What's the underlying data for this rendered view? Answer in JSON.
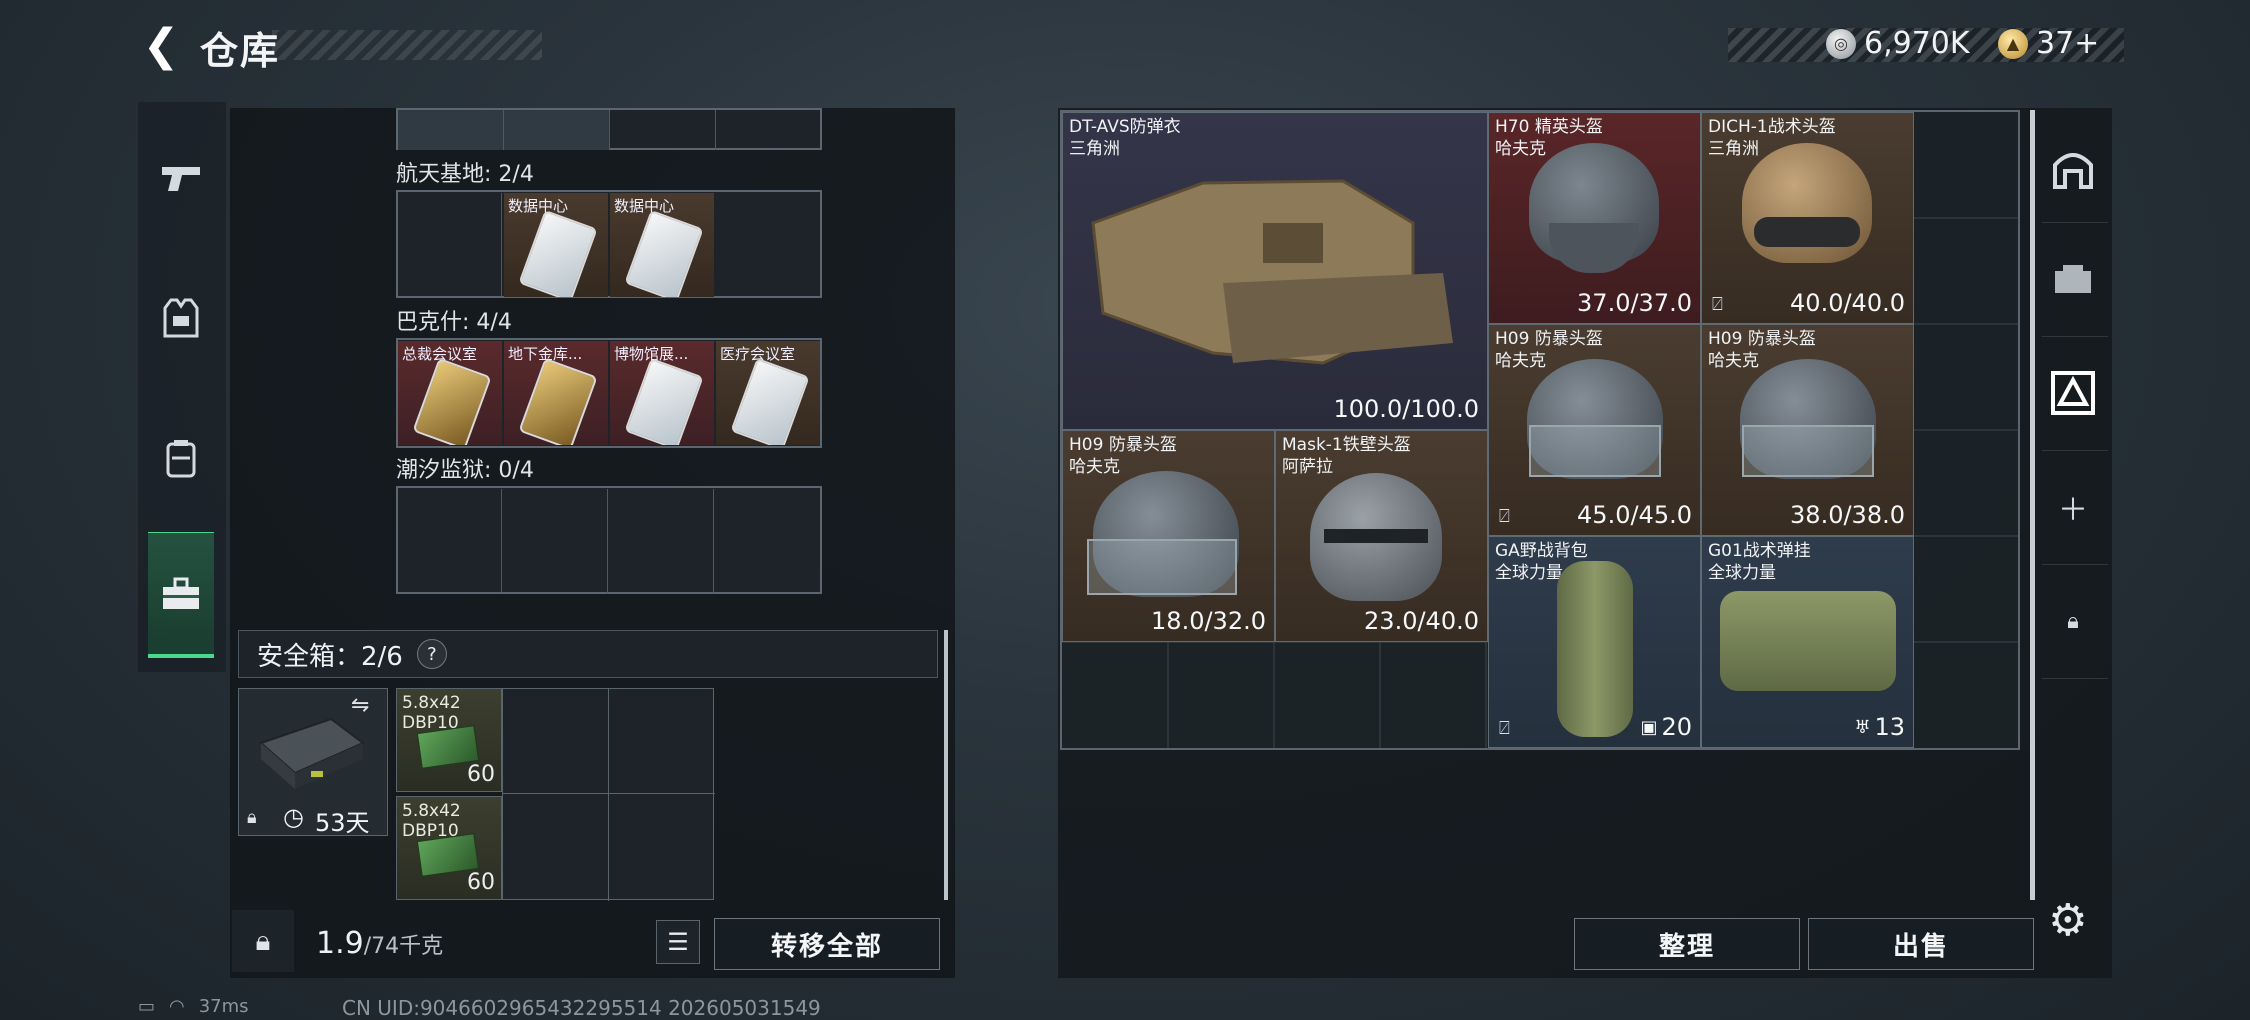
{
  "header": {
    "title": "仓库",
    "currency": {
      "silver": "6,970K",
      "gold": "37+"
    }
  },
  "left_nav": [
    "weapons",
    "equipment",
    "backpack",
    "keys"
  ],
  "key_regions": [
    {
      "label": "航天基地: 2/4",
      "cards": [
        {
          "label": "",
          "style": "empty"
        },
        {
          "label": "数据中心",
          "style": "brown"
        },
        {
          "label": "数据中心",
          "style": "brown"
        },
        {
          "label": "",
          "style": "empty"
        }
      ]
    },
    {
      "label": "巴克什: 4/4",
      "cards": [
        {
          "label": "总裁会议室",
          "style": "red"
        },
        {
          "label": "地下金库...",
          "style": "red"
        },
        {
          "label": "博物馆展...",
          "style": "red"
        },
        {
          "label": "医疗会议室",
          "style": "brown"
        }
      ]
    },
    {
      "label": "潮汐监狱: 0/4"
    }
  ],
  "safe_box": {
    "label": "安全箱：2/6",
    "help": "?",
    "days": "53天",
    "ammo": [
      {
        "name": "5.8x42\nDBP10",
        "count": "60"
      },
      {
        "name": "5.8x42\nDBP10",
        "count": "60"
      }
    ]
  },
  "weight": {
    "current": "1.9",
    "max": "/74千克"
  },
  "buttons": {
    "transfer_all": "转移全部",
    "organize": "整理",
    "sell": "出售"
  },
  "stash_items": [
    {
      "name": "DT-AVS防弹衣",
      "sub": "三角洲",
      "value": "100.0/100.0"
    },
    {
      "name": "H70 精英头盔",
      "sub": "哈夫克",
      "value": "37.0/37.0"
    },
    {
      "name": "DICH-1战术头盔",
      "sub": "三角洲",
      "value": "40.0/40.0"
    },
    {
      "name": "H09 防暴头盔",
      "sub": "哈夫克",
      "value": "45.0/45.0"
    },
    {
      "name": "H09 防暴头盔",
      "sub": "哈夫克",
      "value": "38.0/38.0"
    },
    {
      "name": "H09 防暴头盔",
      "sub": "哈夫克",
      "value": "18.0/32.0"
    },
    {
      "name": "Mask-1铁壁头盔",
      "sub": "阿萨拉",
      "value": "23.0/40.0"
    },
    {
      "name": "GA野战背包",
      "sub": "全球力量",
      "value": "20"
    },
    {
      "name": "G01战术弹挂",
      "sub": "全球力量",
      "value": "13"
    }
  ],
  "status": {
    "ping": "37ms",
    "uid": "CN UID:9046602965432295514  202605031549"
  },
  "colors": {
    "accent_green": "#49d98c",
    "rarity_red": "#5a2628",
    "rarity_brown": "#4a3c30",
    "rarity_purple": "#35354a",
    "rarity_blue": "#2f3c4c"
  }
}
